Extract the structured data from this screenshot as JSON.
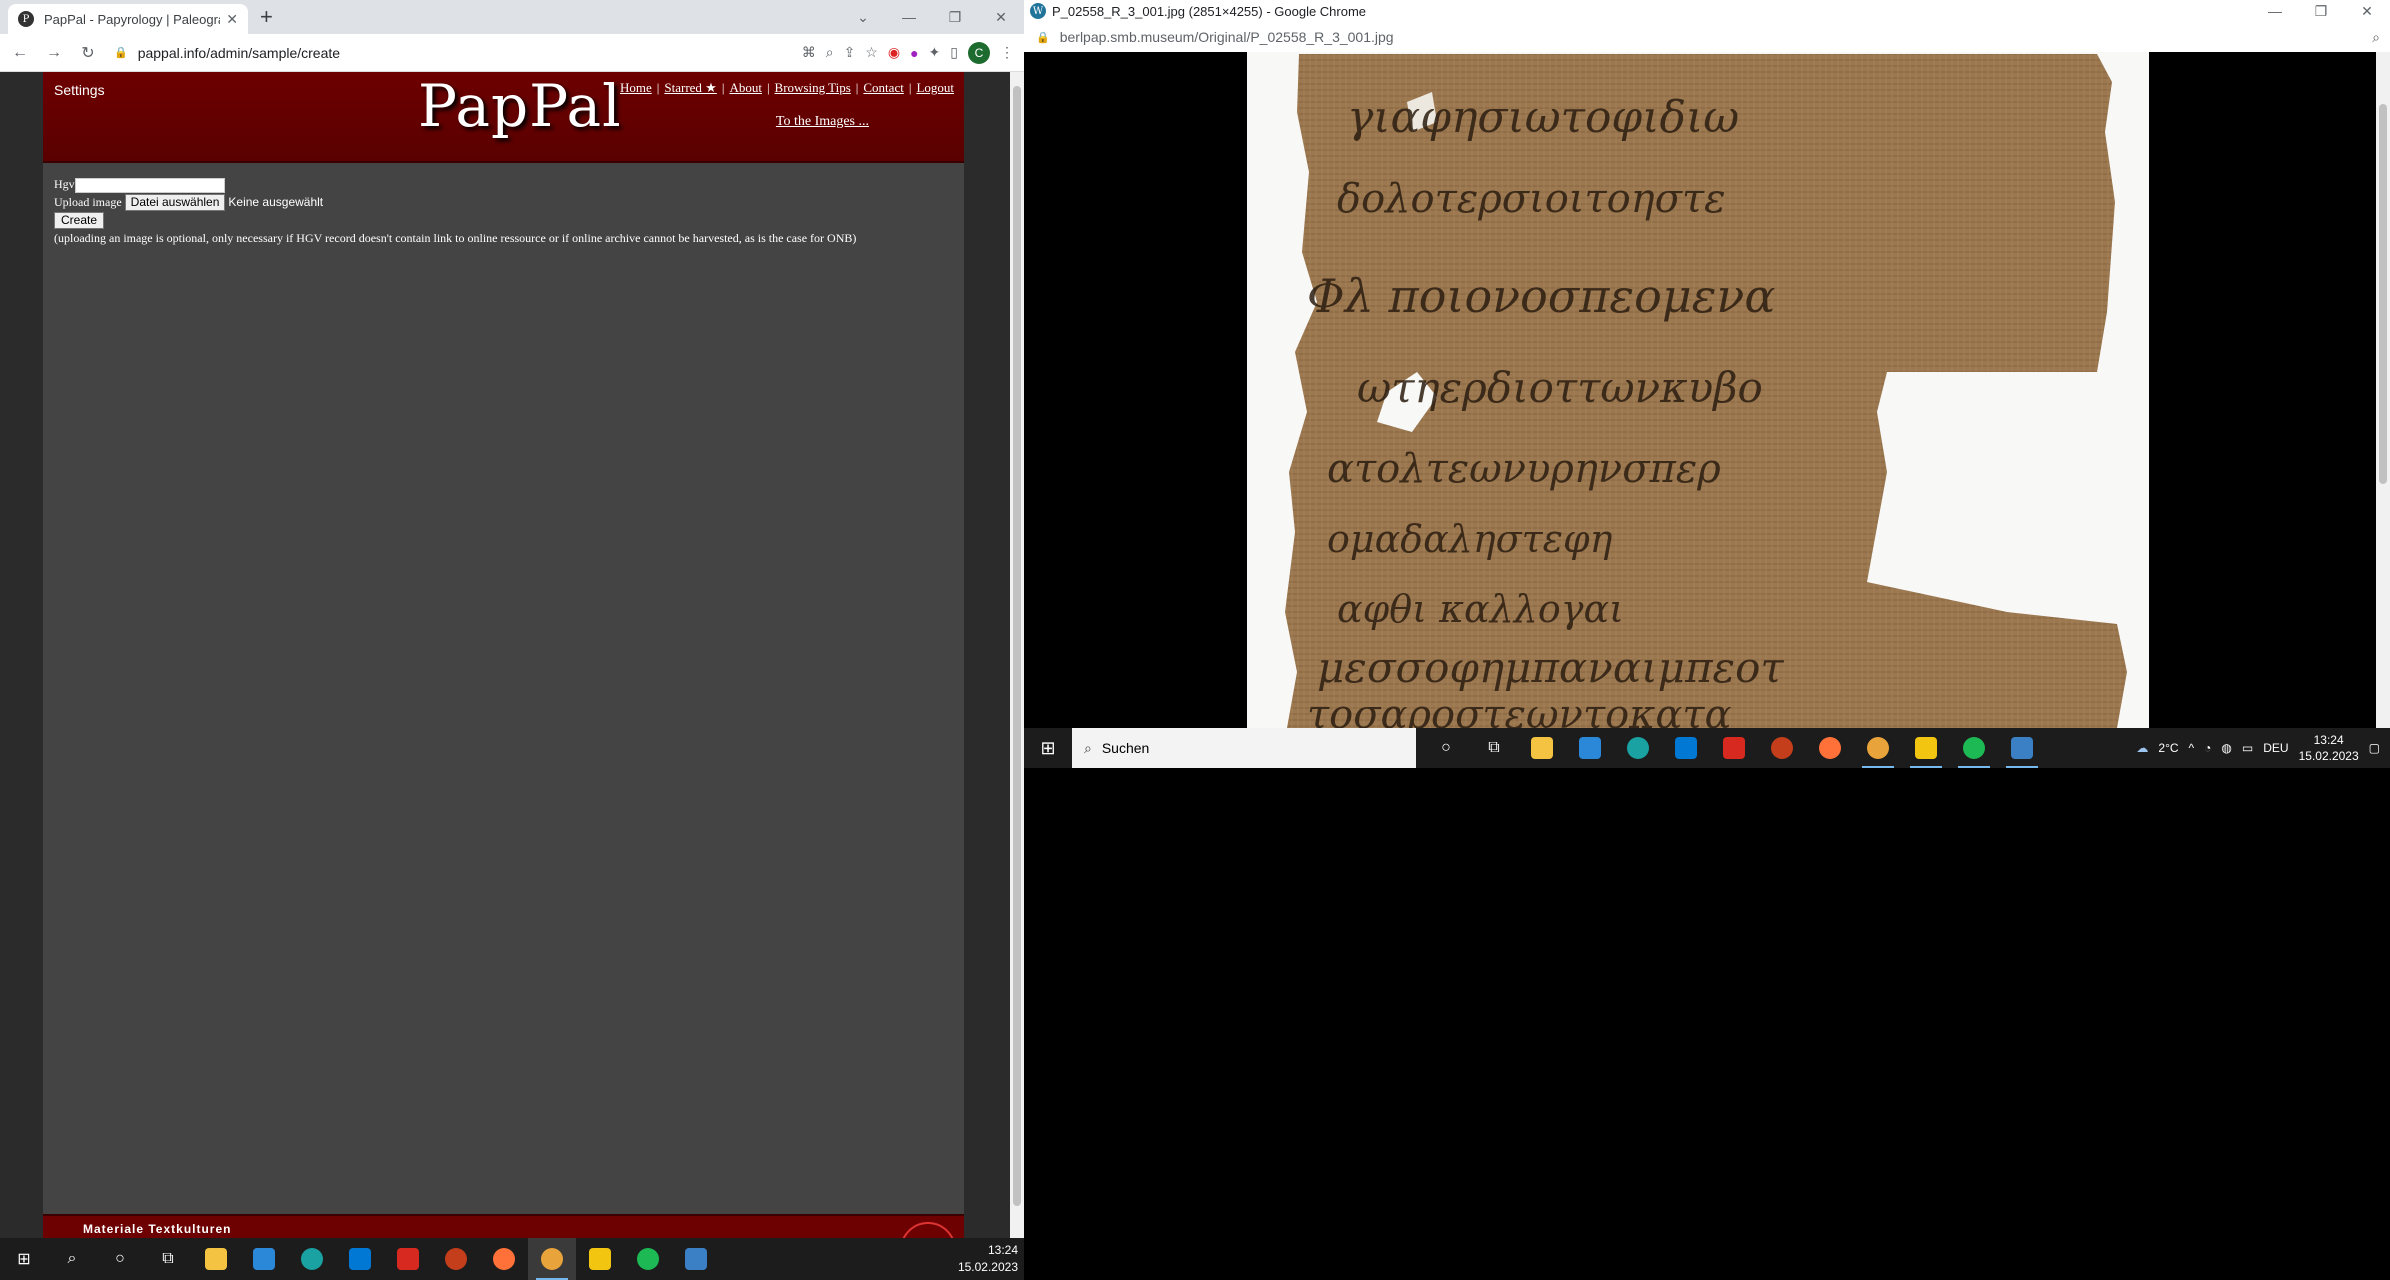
{
  "left_browser": {
    "tab_title": "PapPal - Papyrology | Paleography",
    "url": "pappal.info/admin/sample/create",
    "profile_initial": "C"
  },
  "pappal": {
    "settings_label": "Settings",
    "logo": "PapPal",
    "nav": [
      "Home",
      "Starred ★",
      "About",
      "Browsing Tips",
      "Contact",
      "Logout"
    ],
    "to_images": "To the Images ...",
    "form": {
      "hgv_label": "Hgv",
      "hgv_value": "",
      "upload_label": "Upload image",
      "file_button": "Datei auswählen",
      "file_status": "Keine ausgewählt",
      "create_button": "Create",
      "note": "(uploading an image is optional, only necessary if HGV record doesn't contain link to online ressource or if online archive cannot be harvested, as is the case for ONB)"
    },
    "footer_text": "Materiale Textkulturen"
  },
  "right_browser": {
    "window_title": "P_02558_R_3_001.jpg (2851×4255) - Google Chrome",
    "url": "berlpap.smb.museum/Original/P_02558_R_3_001.jpg"
  },
  "right_taskbar": {
    "search_placeholder": "Suchen",
    "weather": "2°C",
    "language": "DEU",
    "time": "13:24",
    "date": "15.02.2023"
  },
  "bottom_taskbar": {
    "time": "13:24",
    "date": "15.02.2023"
  },
  "colors": {
    "header_red": "#6d0000",
    "page_bg": "#444444",
    "papyrus": "#9c7850"
  }
}
